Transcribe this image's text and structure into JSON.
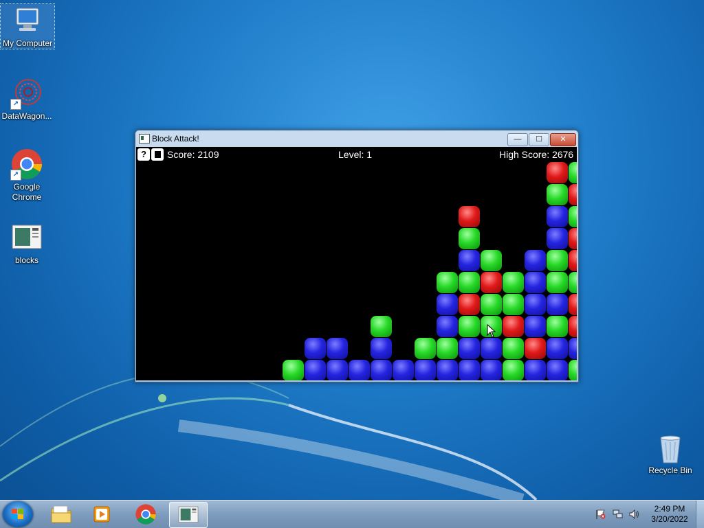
{
  "desktop": {
    "icons": [
      {
        "label": "My Computer",
        "icon": "computer-icon"
      },
      {
        "label": "DataWagon...",
        "icon": "datawagon-icon"
      },
      {
        "label": "Google Chrome",
        "icon": "chrome-icon"
      },
      {
        "label": "blocks",
        "icon": "blocks-app-icon"
      },
      {
        "label": "Recycle Bin",
        "icon": "recycle-bin-icon"
      }
    ]
  },
  "window": {
    "title": "Block Attack!",
    "buttons": {
      "minimize": "—",
      "maximize": "☐",
      "close": "✕"
    }
  },
  "game": {
    "help_label": "?",
    "score_text": "Score: 2109",
    "level_text": "Level: 1",
    "high_score_text": "High Score: 2676",
    "grid": {
      "columns": 20,
      "rows": 10,
      "board": [
        "...............r....g",
        "...............g....r",
        "..............b..r..g",
        "...............b....r",
        "...........b..bg....g",
        "..........gg.ggr....g",
        "..........brgg.bb...r",
        ".....g....bgg.rbg...r",
        "....bb.b.gg.bgbrb...b",
        "...gbbbbbbbbbbgbb...g"
      ],
      "cells": [
        {
          "c": 18,
          "r": 0,
          "k": "red"
        },
        {
          "c": 19,
          "r": 0,
          "k": "green"
        },
        {
          "c": 18,
          "r": 1,
          "k": "green"
        },
        {
          "c": 19,
          "r": 1,
          "k": "red"
        },
        {
          "c": 14,
          "r": 2,
          "k": "red"
        },
        {
          "c": 18,
          "r": 2,
          "k": "blue"
        },
        {
          "c": 19,
          "r": 2,
          "k": "green"
        },
        {
          "c": 14,
          "r": 3,
          "k": "green"
        },
        {
          "c": 18,
          "r": 3,
          "k": "blue"
        },
        {
          "c": 19,
          "r": 3,
          "k": "red"
        },
        {
          "c": 14,
          "r": 4,
          "k": "blue"
        },
        {
          "c": 15,
          "r": 4,
          "k": "green"
        },
        {
          "c": 17,
          "r": 4,
          "k": "blue"
        },
        {
          "c": 18,
          "r": 4,
          "k": "green"
        },
        {
          "c": 19,
          "r": 4,
          "k": "red"
        },
        {
          "c": 13,
          "r": 5,
          "k": "green"
        },
        {
          "c": 14,
          "r": 5,
          "k": "green"
        },
        {
          "c": 15,
          "r": 5,
          "k": "red"
        },
        {
          "c": 16,
          "r": 5,
          "k": "green"
        },
        {
          "c": 17,
          "r": 5,
          "k": "blue"
        },
        {
          "c": 18,
          "r": 5,
          "k": "green"
        },
        {
          "c": 19,
          "r": 5,
          "k": "green"
        },
        {
          "c": 13,
          "r": 6,
          "k": "blue"
        },
        {
          "c": 14,
          "r": 6,
          "k": "red"
        },
        {
          "c": 15,
          "r": 6,
          "k": "green"
        },
        {
          "c": 16,
          "r": 6,
          "k": "green"
        },
        {
          "c": 17,
          "r": 6,
          "k": "blue"
        },
        {
          "c": 18,
          "r": 6,
          "k": "blue"
        },
        {
          "c": 19,
          "r": 6,
          "k": "red"
        },
        {
          "c": 10,
          "r": 7,
          "k": "green"
        },
        {
          "c": 13,
          "r": 7,
          "k": "blue"
        },
        {
          "c": 14,
          "r": 7,
          "k": "green"
        },
        {
          "c": 15,
          "r": 7,
          "k": "green"
        },
        {
          "c": 16,
          "r": 7,
          "k": "red"
        },
        {
          "c": 17,
          "r": 7,
          "k": "blue"
        },
        {
          "c": 18,
          "r": 7,
          "k": "green"
        },
        {
          "c": 19,
          "r": 7,
          "k": "red"
        },
        {
          "c": 7,
          "r": 8,
          "k": "blue"
        },
        {
          "c": 8,
          "r": 8,
          "k": "blue"
        },
        {
          "c": 10,
          "r": 8,
          "k": "blue"
        },
        {
          "c": 12,
          "r": 8,
          "k": "green"
        },
        {
          "c": 13,
          "r": 8,
          "k": "green"
        },
        {
          "c": 14,
          "r": 8,
          "k": "blue"
        },
        {
          "c": 15,
          "r": 8,
          "k": "blue"
        },
        {
          "c": 16,
          "r": 8,
          "k": "green"
        },
        {
          "c": 17,
          "r": 8,
          "k": "red"
        },
        {
          "c": 18,
          "r": 8,
          "k": "blue"
        },
        {
          "c": 19,
          "r": 8,
          "k": "blue"
        },
        {
          "c": 6,
          "r": 9,
          "k": "green"
        },
        {
          "c": 7,
          "r": 9,
          "k": "blue"
        },
        {
          "c": 8,
          "r": 9,
          "k": "blue"
        },
        {
          "c": 9,
          "r": 9,
          "k": "blue"
        },
        {
          "c": 10,
          "r": 9,
          "k": "blue"
        },
        {
          "c": 11,
          "r": 9,
          "k": "blue"
        },
        {
          "c": 12,
          "r": 9,
          "k": "blue"
        },
        {
          "c": 13,
          "r": 9,
          "k": "blue"
        },
        {
          "c": 14,
          "r": 9,
          "k": "blue"
        },
        {
          "c": 15,
          "r": 9,
          "k": "blue"
        },
        {
          "c": 16,
          "r": 9,
          "k": "green"
        },
        {
          "c": 17,
          "r": 9,
          "k": "blue"
        },
        {
          "c": 18,
          "r": 9,
          "k": "blue"
        },
        {
          "c": 19,
          "r": 9,
          "k": "green"
        }
      ]
    },
    "colors": {
      "blue": "#2424e0",
      "green": "#27d827",
      "red": "#e01818"
    }
  },
  "taskbar": {
    "items": [
      {
        "icon": "start-orb-icon"
      },
      {
        "icon": "file-explorer-icon"
      },
      {
        "icon": "media-player-icon"
      },
      {
        "icon": "chrome-icon"
      },
      {
        "icon": "blocks-app-icon",
        "active": true
      }
    ],
    "tray": {
      "icons": [
        "action-center-flag-icon",
        "network-icon",
        "volume-icon"
      ],
      "time": "2:49 PM",
      "date": "3/20/2022"
    }
  }
}
